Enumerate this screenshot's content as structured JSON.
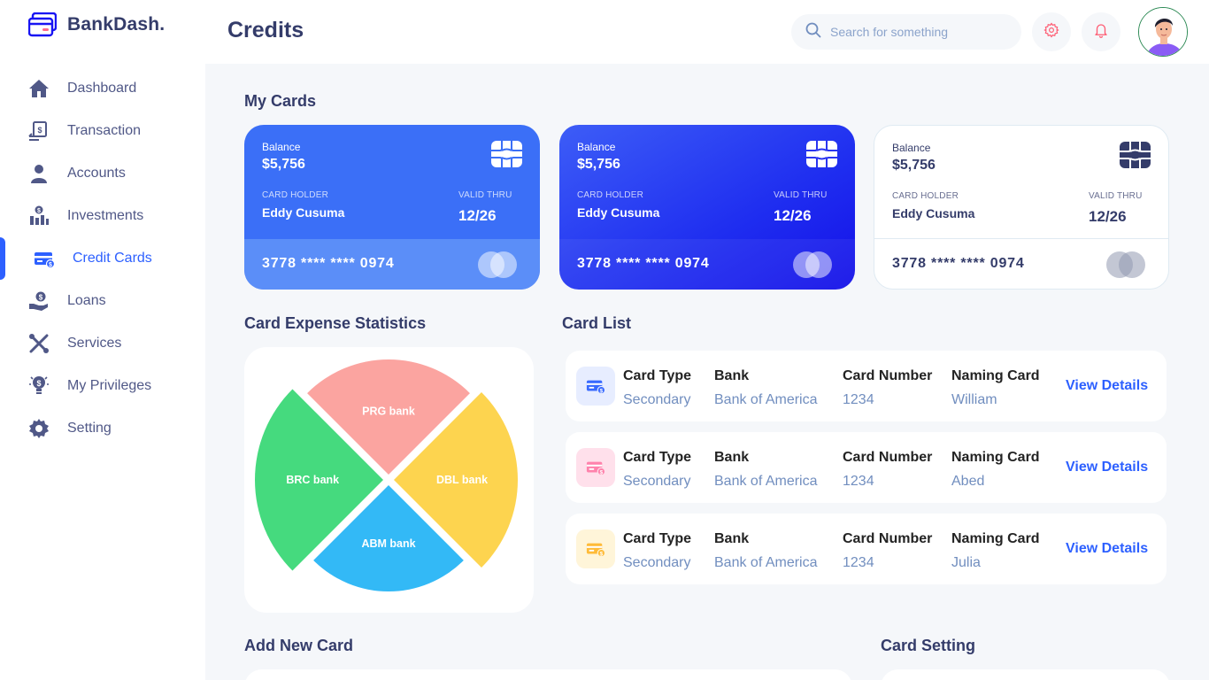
{
  "app": {
    "name": "BankDash."
  },
  "header": {
    "title": "Credits",
    "search_placeholder": "Search for something"
  },
  "sidebar": {
    "items": [
      {
        "label": "Dashboard",
        "icon": "home-icon"
      },
      {
        "label": "Transaction",
        "icon": "transfer-icon"
      },
      {
        "label": "Accounts",
        "icon": "user-icon"
      },
      {
        "label": "Investments",
        "icon": "investment-icon"
      },
      {
        "label": "Credit Cards",
        "icon": "credit-card-icon",
        "active": true
      },
      {
        "label": "Loans",
        "icon": "loan-icon"
      },
      {
        "label": "Services",
        "icon": "services-icon"
      },
      {
        "label": "My Privileges",
        "icon": "privileges-icon"
      },
      {
        "label": "Setting",
        "icon": "gear-icon"
      }
    ]
  },
  "sections": {
    "my_cards": "My Cards",
    "expense_stats": "Card Expense Statistics",
    "card_list": "Card List",
    "add_new_card": "Add New Card",
    "card_setting": "Card Setting"
  },
  "cards": [
    {
      "balance_label": "Balance",
      "balance": "$5,756",
      "holder_label": "CARD HOLDER",
      "holder": "Eddy Cusuma",
      "valid_label": "VALID THRU",
      "valid": "12/26",
      "number": "3778 **** **** 0974",
      "style": "blue"
    },
    {
      "balance_label": "Balance",
      "balance": "$5,756",
      "holder_label": "CARD HOLDER",
      "holder": "Eddy Cusuma",
      "valid_label": "VALID THRU",
      "valid": "12/26",
      "number": "3778 **** **** 0974",
      "style": "blue-dark"
    },
    {
      "balance_label": "Balance",
      "balance": "$5,756",
      "holder_label": "CARD HOLDER",
      "holder": "Eddy Cusuma",
      "valid_label": "VALID THRU",
      "valid": "12/26",
      "number": "3778 **** **** 0974",
      "style": "white"
    }
  ],
  "chart_data": {
    "type": "pie",
    "title": "Card Expense Statistics",
    "categories": [
      "PRG bank",
      "DBL bank",
      "ABM bank",
      "BRC bank"
    ],
    "values": [
      25,
      25,
      25,
      25
    ],
    "colors": [
      "#fba4a0",
      "#fdd44f",
      "#33b9f6",
      "#45da7e"
    ]
  },
  "card_list": {
    "headers": {
      "type": "Card Type",
      "bank": "Bank",
      "number": "Card Number",
      "naming": "Naming Card"
    },
    "action_label": "View Details",
    "rows": [
      {
        "type": "Secondary",
        "bank": "Bank of America",
        "number": "1234",
        "naming": "William",
        "icon_color": "#396aff",
        "icon_bg": "#e7edff"
      },
      {
        "type": "Secondary",
        "bank": "Bank of America",
        "number": "1234",
        "naming": "Abed",
        "icon_color": "#ff82ac",
        "icon_bg": "#ffe0eb"
      },
      {
        "type": "Secondary",
        "bank": "Bank of America",
        "number": "1234",
        "naming": "Julia",
        "icon_color": "#ffbb38",
        "icon_bg": "#fff5d9"
      }
    ]
  },
  "colors": {
    "accent": "#2d60ff",
    "text_dark": "#343c6a",
    "text_muted": "#718ebf"
  }
}
